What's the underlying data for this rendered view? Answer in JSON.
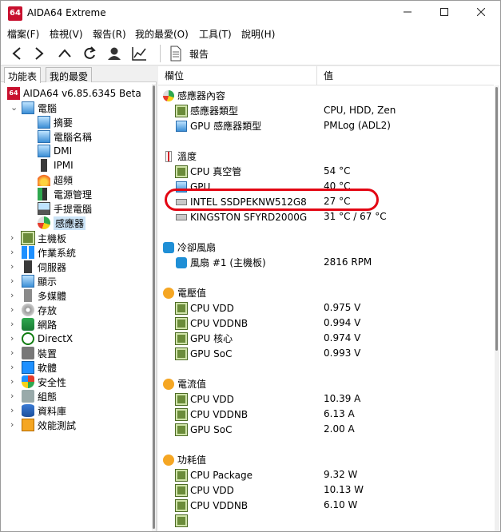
{
  "window": {
    "title": "AIDA64 Extreme",
    "icon_text": "64"
  },
  "menu": [
    "檔案(F)",
    "檢視(V)",
    "報告(R)",
    "我的最愛(O)",
    "工具(T)",
    "說明(H)"
  ],
  "toolbar": {
    "report_label": "報告"
  },
  "tabs": {
    "menu_tab": "功能表",
    "favorites_tab": "我的最愛"
  },
  "tree": {
    "root": "AIDA64 v6.85.6345 Beta",
    "computer": "電腦",
    "computer_children": [
      "摘要",
      "電腦名稱",
      "DMI",
      "IPMI",
      "超頻",
      "電源管理",
      "手提電腦",
      "感應器"
    ],
    "top_items": [
      "主機板",
      "作業系統",
      "伺服器",
      "顯示",
      "多媒體",
      "存放",
      "網路",
      "DirectX",
      "裝置",
      "軟體",
      "安全性",
      "組態",
      "資料庫",
      "效能測試"
    ]
  },
  "columns": {
    "field": "欄位",
    "value": "值"
  },
  "sections": {
    "sensor_props": "感應器內容",
    "temperature": "溫度",
    "fans": "冷卻風扇",
    "voltage": "電壓值",
    "current": "電流值",
    "power": "功耗值"
  },
  "rows": {
    "sensor_type_label": "感應器類型",
    "sensor_type_value": "CPU, HDD, Zen",
    "gpu_sensor_type_label": "GPU 感應器類型",
    "gpu_sensor_type_value": "PMLog  (ADL2)",
    "cpu_die_label": "CPU 真空管",
    "cpu_die_value": "54 °C",
    "gpu_temp_label": "GPU",
    "gpu_temp_value": "40 °C",
    "intel_ssd_label": "INTEL SSDPEKNW512G8",
    "intel_ssd_value": "27 °C",
    "kingston_label": "KINGSTON SFYRD2000G",
    "kingston_value": "31 °C / 67 °C",
    "fan1_label": "風扇 #1 (主機板)",
    "fan1_value": "2816 RPM",
    "v_cpu_vdd_label": "CPU VDD",
    "v_cpu_vdd_value": "0.975 V",
    "v_cpu_vddnb_label": "CPU VDDNB",
    "v_cpu_vddnb_value": "0.994 V",
    "v_gpu_core_label": "GPU 核心",
    "v_gpu_core_value": "0.974 V",
    "v_gpu_soc_label": "GPU SoC",
    "v_gpu_soc_value": "0.993 V",
    "a_cpu_vdd_label": "CPU VDD",
    "a_cpu_vdd_value": "10.39 A",
    "a_cpu_vddnb_label": "CPU VDDNB",
    "a_cpu_vddnb_value": "6.13 A",
    "a_gpu_soc_label": "GPU SoC",
    "a_gpu_soc_value": "2.00 A",
    "p_cpu_package_label": "CPU Package",
    "p_cpu_package_value": "9.32 W",
    "p_cpu_vdd_label": "CPU VDD",
    "p_cpu_vdd_value": "10.13 W",
    "p_cpu_vddnb_label": "CPU VDDNB",
    "p_cpu_vddnb_value": "6.10 W"
  },
  "colors": {
    "accent": "#c8102e",
    "selection": "#cce4f7",
    "highlight_oval": "#e30613"
  }
}
